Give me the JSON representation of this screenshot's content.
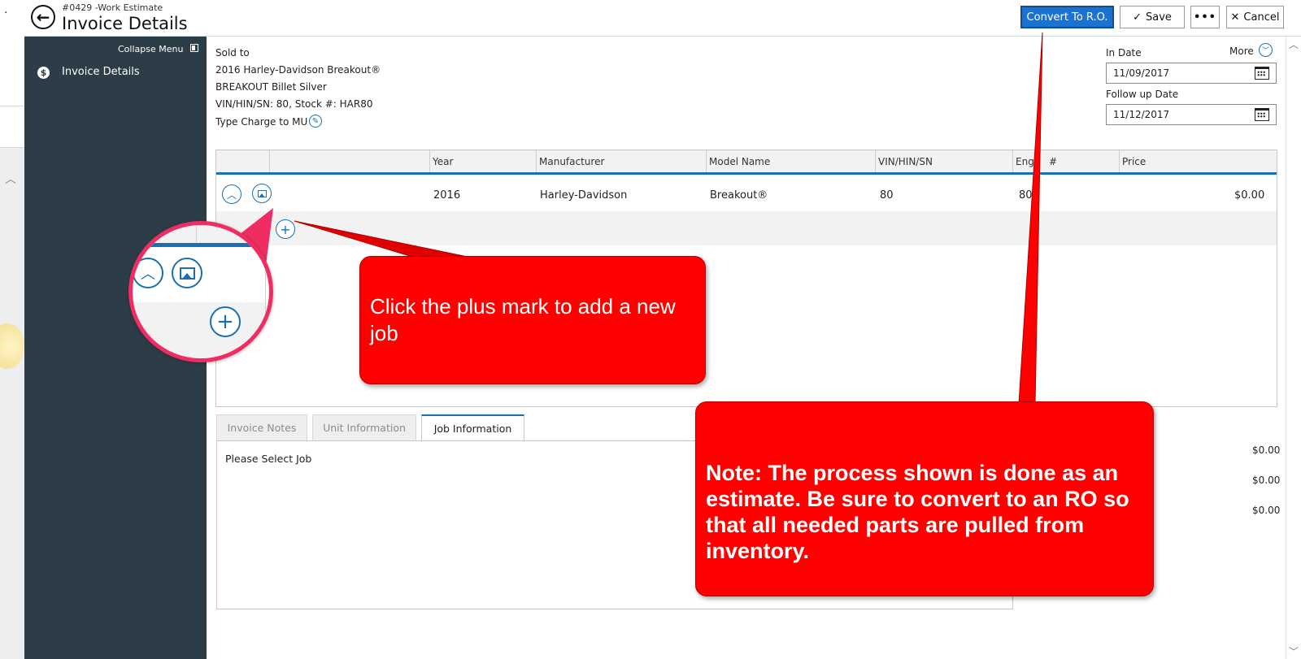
{
  "header": {
    "subtitle": "#0429 -Work Estimate",
    "title": "Invoice Details",
    "back_icon": "back-arrow-icon",
    "buttons": {
      "convert": "Convert To R.O.",
      "save": "Save",
      "more": "•••",
      "cancel": "Cancel"
    }
  },
  "sidebar": {
    "collapse_label": "Collapse Menu",
    "items": [
      {
        "label": "Invoice Details",
        "icon": "dollar-circle-icon"
      }
    ]
  },
  "customer": {
    "sold_to": "Sold to",
    "unit_name": "2016 Harley-Davidson Breakout®",
    "unit_desc": "BREAKOUT Billet Silver",
    "vin_stock": "VIN/HIN/SN: 80, Stock #: HAR80",
    "type": "Type  Charge to MU"
  },
  "dates": {
    "more_label": "More",
    "in_date_label": "In Date",
    "in_date_value": "11/09/2017",
    "follow_up_label": "Follow up Date",
    "follow_up_value": "11/12/2017"
  },
  "grid": {
    "columns": [
      "Year",
      "Manufacturer",
      "Model Name",
      "VIN/HIN/SN",
      "Engi",
      "#",
      "Price"
    ],
    "rows": [
      {
        "year": "2016",
        "manufacturer": "Harley-Davidson",
        "model": "Breakout®",
        "vin": "80",
        "engine": "80",
        "price": "$0.00"
      }
    ]
  },
  "tabs": {
    "items": [
      "Invoice Notes",
      "Unit Information",
      "Job Information"
    ],
    "active": "Job Information",
    "content": "Please Select Job"
  },
  "totals": [
    "$0.00",
    "$0.00",
    "$0.00"
  ],
  "callouts": {
    "plus": "Click the plus mark to add a new job",
    "note": "Note: The process shown is done as an estimate. Be sure to convert to an RO so that all needed parts are pulled from inventory."
  },
  "colors": {
    "accent_blue": "#1b6fb3",
    "sidebar_bg": "#2d3d48",
    "callout_red": "#ff0000",
    "zoom_ring": "#f02d62"
  }
}
